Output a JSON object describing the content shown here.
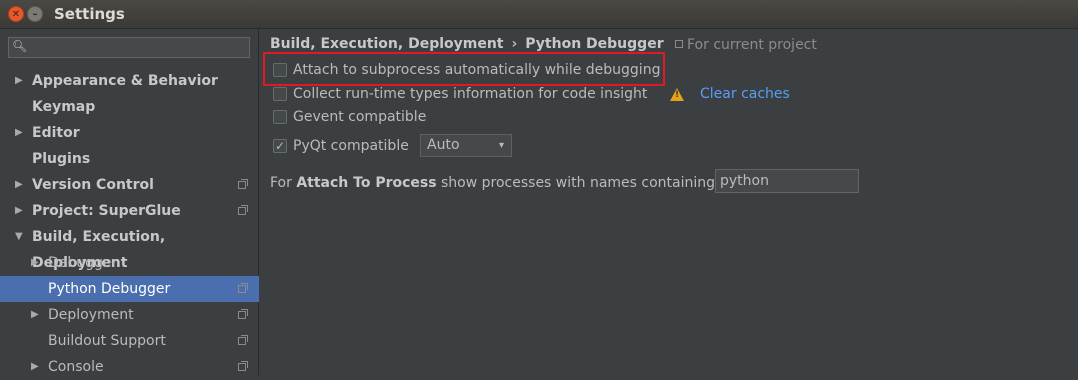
{
  "window": {
    "title": "Settings",
    "close_glyph": "✕",
    "minimize_glyph": "–"
  },
  "sidebar": {
    "search": {
      "placeholder": "",
      "value": "",
      "icon": "search-icon"
    },
    "items": [
      {
        "label": "Appearance & Behavior",
        "expandable": true,
        "expanded": false,
        "level": 0,
        "project_scope": false
      },
      {
        "label": "Keymap",
        "expandable": false,
        "level": 0,
        "project_scope": false
      },
      {
        "label": "Editor",
        "expandable": true,
        "expanded": false,
        "level": 0,
        "project_scope": false
      },
      {
        "label": "Plugins",
        "expandable": false,
        "level": 0,
        "project_scope": false
      },
      {
        "label": "Version Control",
        "expandable": true,
        "expanded": false,
        "level": 0,
        "project_scope": true
      },
      {
        "label": "Project: SuperGlue",
        "expandable": true,
        "expanded": false,
        "level": 0,
        "project_scope": true
      },
      {
        "label": "Build, Execution, Deployment",
        "expandable": true,
        "expanded": true,
        "level": 0,
        "project_scope": false
      },
      {
        "label": "Debugger",
        "expandable": true,
        "expanded": false,
        "level": 1,
        "project_scope": false
      },
      {
        "label": "Python Debugger",
        "expandable": false,
        "level": 1,
        "project_scope": true,
        "selected": true
      },
      {
        "label": "Deployment",
        "expandable": true,
        "expanded": false,
        "level": 1,
        "project_scope": true
      },
      {
        "label": "Buildout Support",
        "expandable": false,
        "level": 1,
        "project_scope": true
      },
      {
        "label": "Console",
        "expandable": true,
        "expanded": false,
        "level": 1,
        "project_scope": true
      }
    ]
  },
  "breadcrumb": {
    "parent": "Build, Execution, Deployment",
    "separator": "›",
    "current": "Python Debugger"
  },
  "scope_note": "For current project",
  "options": {
    "attach_subprocess": {
      "label": "Attach to subprocess automatically while debugging",
      "checked": false
    },
    "collect_types": {
      "label": "Collect run-time types information for code insight",
      "checked": false
    },
    "gevent": {
      "label": "Gevent compatible",
      "checked": false
    },
    "pyqt": {
      "label": "PyQt compatible",
      "checked": true
    }
  },
  "clear_caches_label": "Clear caches",
  "pyqt_select": {
    "value": "Auto",
    "arrow": "▾"
  },
  "attach_process": {
    "prefix": "For ",
    "bold": "Attach To Process",
    "suffix": " show processes with names containing:",
    "value": "python"
  },
  "colors": {
    "background": "#3c3f41",
    "selection": "#4b6eaf",
    "link": "#589df6",
    "highlight_border": "#e01a22",
    "warning": "#e3a21a"
  }
}
